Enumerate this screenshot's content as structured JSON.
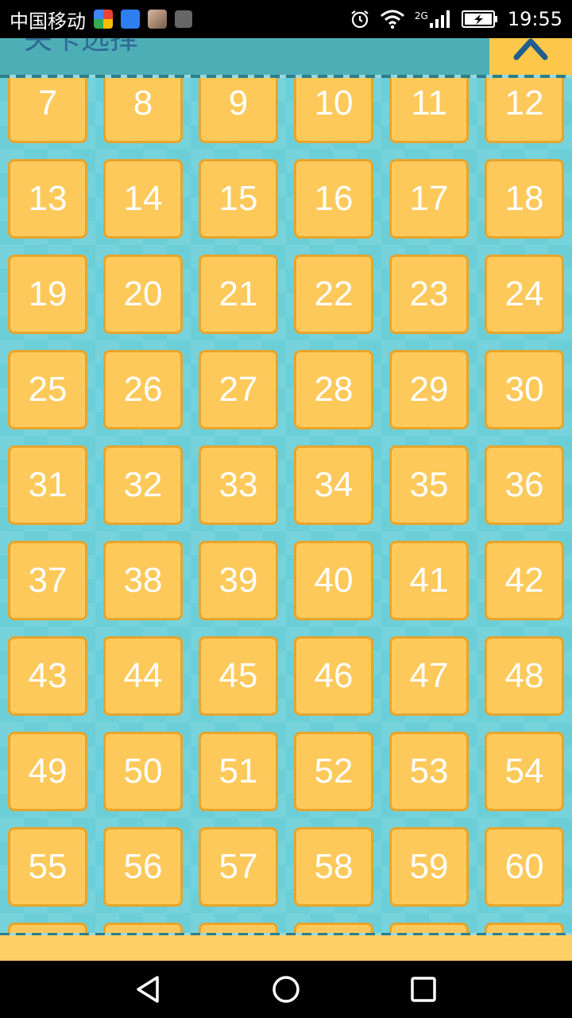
{
  "status_bar": {
    "carrier": "中国移动",
    "network": "2G",
    "time": "19:55",
    "icons": [
      "colorful-app-icon",
      "shield-icon",
      "avatar-photo-icon",
      "gallery-icon",
      "alarm-icon",
      "wifi-icon",
      "signal-icon",
      "battery-charging-icon"
    ]
  },
  "header": {
    "title": "关卡选择",
    "close_icon": "chevron-up-icon",
    "accent_color": "#fcc74a",
    "background_color": "#4eaeb6"
  },
  "levels": [
    "7",
    "8",
    "9",
    "10",
    "11",
    "12",
    "13",
    "14",
    "15",
    "16",
    "17",
    "18",
    "19",
    "20",
    "21",
    "22",
    "23",
    "24",
    "25",
    "26",
    "27",
    "28",
    "29",
    "30",
    "31",
    "32",
    "33",
    "34",
    "35",
    "36",
    "37",
    "38",
    "39",
    "40",
    "41",
    "42",
    "43",
    "44",
    "45",
    "46",
    "47",
    "48",
    "49",
    "50",
    "51",
    "52",
    "53",
    "54",
    "55",
    "56",
    "57",
    "58",
    "59",
    "60"
  ],
  "colors": {
    "tile": "#fdc95b",
    "tile_border": "#e7a52c",
    "content_background": "#6ccfd8"
  },
  "nav_bar": {
    "icons": [
      "back-icon",
      "home-icon",
      "recents-icon"
    ]
  }
}
